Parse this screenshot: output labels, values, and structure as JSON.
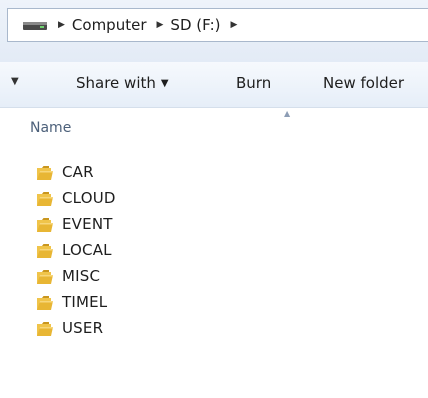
{
  "address_bar": {
    "drive_icon": "drive-icon",
    "crumbs": [
      "Computer",
      "SD (F:)"
    ]
  },
  "toolbar": {
    "share_label": "Share with",
    "burn_label": "Burn",
    "new_folder_label": "New folder"
  },
  "columns": {
    "name_label": "Name"
  },
  "files": [
    {
      "name": "CAR",
      "icon": "folder-icon"
    },
    {
      "name": "CLOUD",
      "icon": "folder-icon"
    },
    {
      "name": "EVENT",
      "icon": "folder-icon"
    },
    {
      "name": "LOCAL",
      "icon": "folder-icon"
    },
    {
      "name": "MISC",
      "icon": "folder-icon"
    },
    {
      "name": "TIMEL",
      "icon": "folder-icon"
    },
    {
      "name": "USER",
      "icon": "folder-icon"
    }
  ],
  "colors": {
    "folder": "#e8b634",
    "header_text": "#4c607a",
    "toolbar_bg": "#e6eef8"
  }
}
